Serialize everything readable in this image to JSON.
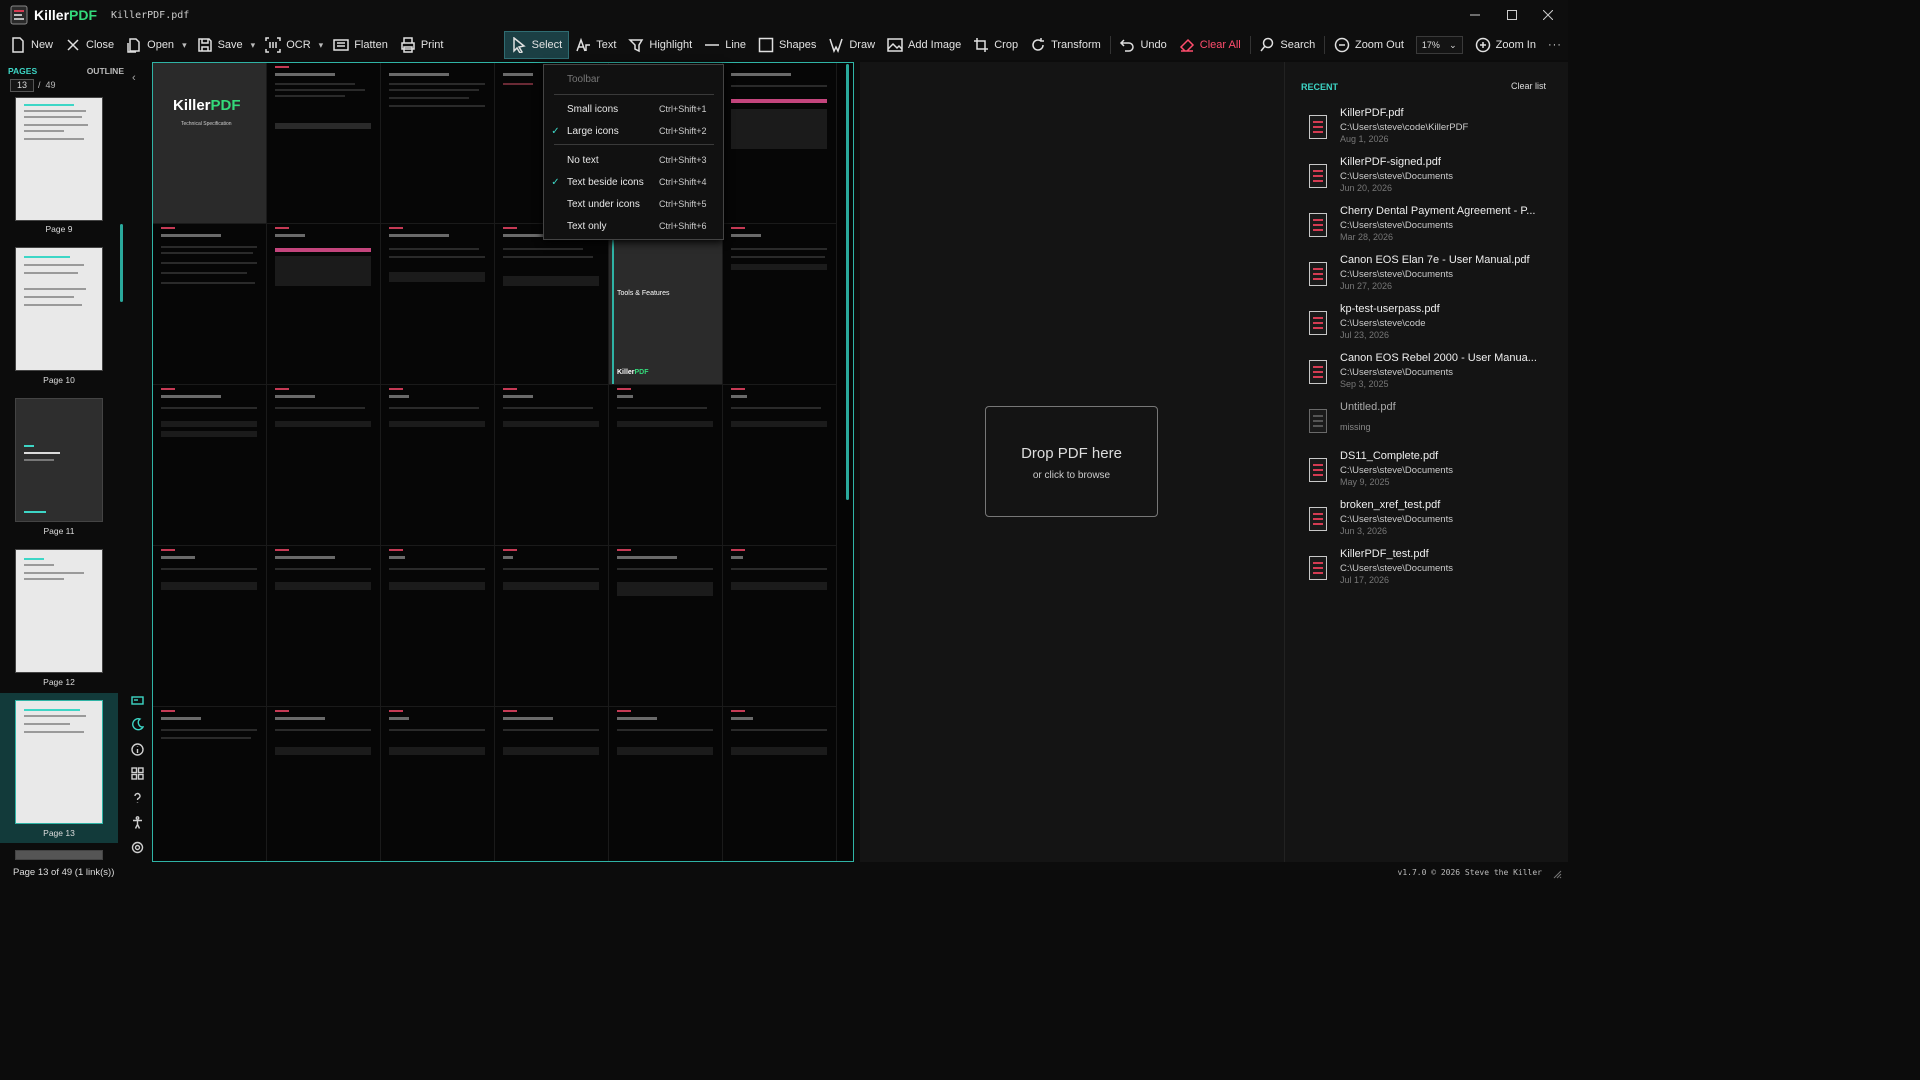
{
  "app": {
    "brand_a": "Killer",
    "brand_b": "PDF",
    "file": "KillerPDF.pdf"
  },
  "toolbar": {
    "new": "New",
    "close": "Close",
    "open": "Open",
    "save": "Save",
    "ocr": "OCR",
    "flatten": "Flatten",
    "print": "Print",
    "select": "Select",
    "text": "Text",
    "highlight": "Highlight",
    "line": "Line",
    "shapes": "Shapes",
    "draw": "Draw",
    "add_image": "Add Image",
    "crop": "Crop",
    "transform": "Transform",
    "undo": "Undo",
    "clear_all": "Clear All",
    "search": "Search",
    "zoom_out": "Zoom Out",
    "zoom_value": "17%",
    "zoom_in": "Zoom In"
  },
  "sidebar": {
    "tab_pages": "PAGES",
    "tab_outline": "OUTLINE",
    "current_page": "13",
    "total_pages": "49",
    "thumbs": [
      "Page 9",
      "Page 10",
      "Page 11",
      "Page 12",
      "Page 13"
    ]
  },
  "grid_pages": {
    "cover_brand_a": "Killer",
    "cover_brand_b": "PDF",
    "cover_sub": "Technical Specification",
    "section_title": "Tools & Features",
    "section_logo_a": "Killer",
    "section_logo_b": "PDF"
  },
  "toolbar_menu": {
    "header": "Toolbar",
    "items": [
      {
        "label": "Small icons",
        "shortcut": "Ctrl+Shift+1",
        "checked": ""
      },
      {
        "label": "Large icons",
        "shortcut": "Ctrl+Shift+2",
        "checked": "✓"
      },
      {
        "label": "No text",
        "shortcut": "Ctrl+Shift+3",
        "checked": ""
      },
      {
        "label": "Text beside icons",
        "shortcut": "Ctrl+Shift+4",
        "checked": "✓"
      },
      {
        "label": "Text under icons",
        "shortcut": "Ctrl+Shift+5",
        "checked": ""
      },
      {
        "label": "Text only",
        "shortcut": "Ctrl+Shift+6",
        "checked": ""
      }
    ]
  },
  "dropzone": {
    "title": "Drop PDF here",
    "subtitle": "or click to browse"
  },
  "recent": {
    "heading": "RECENT",
    "clear": "Clear list",
    "items": [
      {
        "name": "KillerPDF.pdf",
        "path": "C:\\Users\\steve\\code\\KillerPDF",
        "date": "Aug 1, 2026"
      },
      {
        "name": "KillerPDF-signed.pdf",
        "path": "C:\\Users\\steve\\Documents",
        "date": "Jun 20, 2026"
      },
      {
        "name": "Cherry Dental Payment Agreement - P...",
        "path": "C:\\Users\\steve\\Documents",
        "date": "Mar 28, 2026"
      },
      {
        "name": "Canon EOS Elan 7e - User Manual.pdf",
        "path": "C:\\Users\\steve\\Documents",
        "date": "Jun 27, 2026"
      },
      {
        "name": "kp-test-userpass.pdf",
        "path": "C:\\Users\\steve\\code",
        "date": "Jul 23, 2026"
      },
      {
        "name": "Canon EOS Rebel 2000 - User Manua...",
        "path": "C:\\Users\\steve\\Documents",
        "date": "Sep 3, 2025"
      },
      {
        "name": "Untitled.pdf",
        "status": "missing"
      },
      {
        "name": "DS11_Complete.pdf",
        "path": "C:\\Users\\steve\\Documents",
        "date": "May 9, 2025"
      },
      {
        "name": "broken_xref_test.pdf",
        "path": "C:\\Users\\steve\\Documents",
        "date": "Jun 3, 2026"
      },
      {
        "name": "KillerPDF_test.pdf",
        "path": "C:\\Users\\steve\\Documents",
        "date": "Jul 17, 2026"
      }
    ]
  },
  "status": {
    "left": "Page 13 of 49 (1 link(s))",
    "right": "v1.7.0  © 2026  Steve the Killer"
  },
  "colors": {
    "accent": "#3dd6c6",
    "brand_green": "#34d97a",
    "danger": "#ff4d6d",
    "pdf_red": "#d43b52"
  }
}
